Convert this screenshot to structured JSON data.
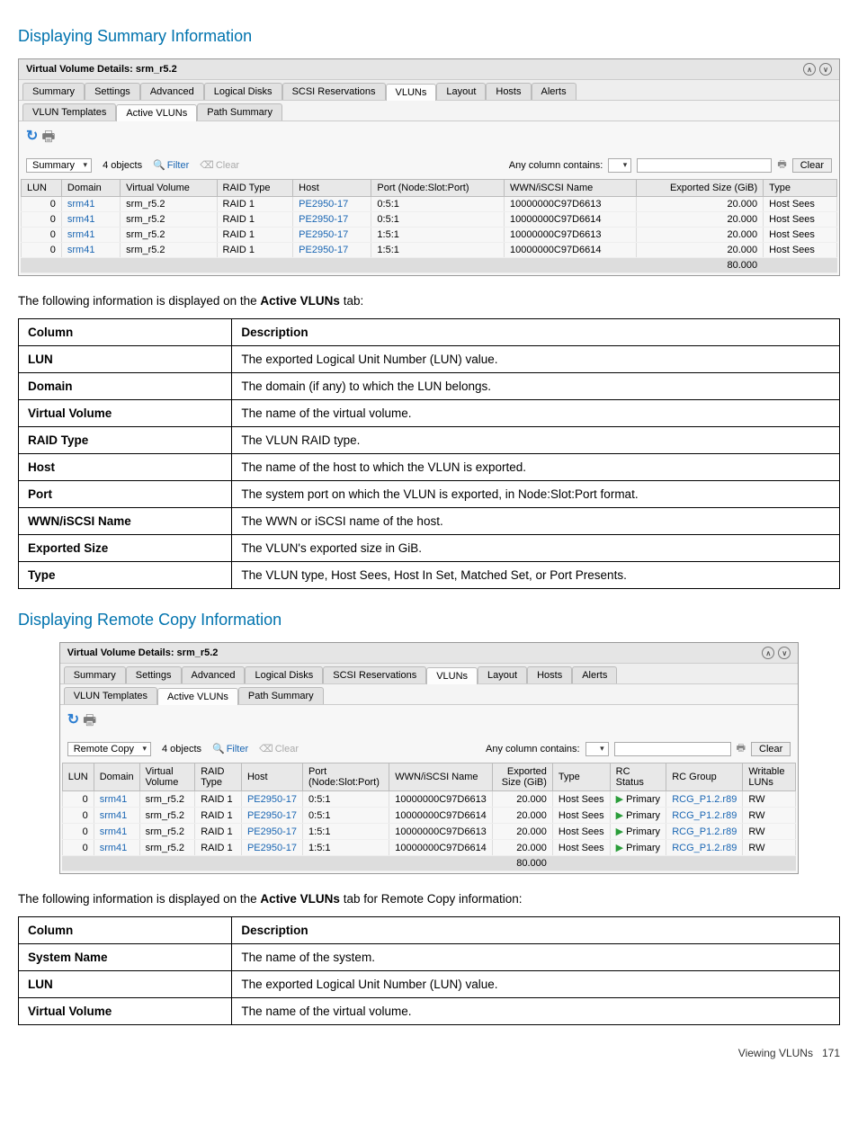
{
  "section1_title": "Displaying Summary Information",
  "section2_title": "Displaying Remote Copy Information",
  "ss1": {
    "title": "Virtual Volume Details: srm_r5.2",
    "tabs": [
      "Summary",
      "Settings",
      "Advanced",
      "Logical Disks",
      "SCSI Reservations",
      "VLUNs",
      "Layout",
      "Hosts",
      "Alerts"
    ],
    "active_tab": "VLUNs",
    "subtabs": [
      "VLUN Templates",
      "Active VLUNs",
      "Path Summary"
    ],
    "active_subtab": "Active VLUNs",
    "view_dd": "Summary",
    "objects": "4 objects",
    "filter": "Filter",
    "clear": "Clear",
    "anycol": "Any column contains:",
    "clear_btn": "Clear",
    "headers": [
      "LUN",
      "Domain",
      "Virtual Volume",
      "RAID Type",
      "Host",
      "Port (Node:Slot:Port)",
      "WWN/iSCSI Name",
      "Exported Size (GiB)",
      "Type"
    ],
    "rows": [
      {
        "lun": "0",
        "domain": "srm41",
        "vv": "srm_r5.2",
        "raid": "RAID 1",
        "host": "PE2950-17",
        "port": "0:5:1",
        "wwn": "10000000C97D6613",
        "size": "20.000",
        "type": "Host Sees"
      },
      {
        "lun": "0",
        "domain": "srm41",
        "vv": "srm_r5.2",
        "raid": "RAID 1",
        "host": "PE2950-17",
        "port": "0:5:1",
        "wwn": "10000000C97D6614",
        "size": "20.000",
        "type": "Host Sees"
      },
      {
        "lun": "0",
        "domain": "srm41",
        "vv": "srm_r5.2",
        "raid": "RAID 1",
        "host": "PE2950-17",
        "port": "1:5:1",
        "wwn": "10000000C97D6613",
        "size": "20.000",
        "type": "Host Sees"
      },
      {
        "lun": "0",
        "domain": "srm41",
        "vv": "srm_r5.2",
        "raid": "RAID 1",
        "host": "PE2950-17",
        "port": "1:5:1",
        "wwn": "10000000C97D6614",
        "size": "20.000",
        "type": "Host Sees"
      }
    ],
    "total": "80.000"
  },
  "text1": "The following information is displayed on the ",
  "text1_bold": "Active VLUNs",
  "text1_rest": " tab:",
  "doc1": {
    "h0": "Column",
    "h1": "Description",
    "rows": [
      {
        "c": "LUN",
        "d": "The exported Logical Unit Number (LUN) value."
      },
      {
        "c": "Domain",
        "d": "The domain (if any) to which the LUN belongs."
      },
      {
        "c": "Virtual Volume",
        "d": "The name of the virtual volume."
      },
      {
        "c": "RAID Type",
        "d": "The VLUN RAID type."
      },
      {
        "c": "Host",
        "d": "The name of the host to which the VLUN is exported."
      },
      {
        "c": "Port",
        "d": "The system port on which the VLUN is exported, in Node:Slot:Port format."
      },
      {
        "c": "WWN/iSCSI Name",
        "d": "The WWN or iSCSI name of the host."
      },
      {
        "c": "Exported Size",
        "d": "The VLUN's exported size in GiB."
      },
      {
        "c": "Type",
        "d": "The VLUN type, Host Sees, Host In Set, Matched Set, or Port Presents."
      }
    ]
  },
  "ss2": {
    "title": "Virtual Volume Details: srm_r5.2",
    "tabs": [
      "Summary",
      "Settings",
      "Advanced",
      "Logical Disks",
      "SCSI Reservations",
      "VLUNs",
      "Layout",
      "Hosts",
      "Alerts"
    ],
    "active_tab": "VLUNs",
    "subtabs": [
      "VLUN Templates",
      "Active VLUNs",
      "Path Summary"
    ],
    "active_subtab": "Active VLUNs",
    "view_dd": "Remote Copy",
    "objects": "4 objects",
    "filter": "Filter",
    "clear": "Clear",
    "anycol": "Any column contains:",
    "clear_btn": "Clear",
    "headers": [
      "LUN",
      "Domain",
      "Virtual Volume",
      "RAID Type",
      "Host",
      "Port (Node:Slot:Port)",
      "WWN/iSCSI Name",
      "Exported Size (GiB)",
      "Type",
      "RC Status",
      "RC Group",
      "Writable LUNs"
    ],
    "rows": [
      {
        "lun": "0",
        "domain": "srm41",
        "vv": "srm_r5.2",
        "raid": "RAID 1",
        "host": "PE2950-17",
        "port": "0:5:1",
        "wwn": "10000000C97D6613",
        "size": "20.000",
        "type": "Host Sees",
        "rcs": "Primary",
        "rcg": "RCG_P1.2.r89",
        "wl": "RW"
      },
      {
        "lun": "0",
        "domain": "srm41",
        "vv": "srm_r5.2",
        "raid": "RAID 1",
        "host": "PE2950-17",
        "port": "0:5:1",
        "wwn": "10000000C97D6614",
        "size": "20.000",
        "type": "Host Sees",
        "rcs": "Primary",
        "rcg": "RCG_P1.2.r89",
        "wl": "RW"
      },
      {
        "lun": "0",
        "domain": "srm41",
        "vv": "srm_r5.2",
        "raid": "RAID 1",
        "host": "PE2950-17",
        "port": "1:5:1",
        "wwn": "10000000C97D6613",
        "size": "20.000",
        "type": "Host Sees",
        "rcs": "Primary",
        "rcg": "RCG_P1.2.r89",
        "wl": "RW"
      },
      {
        "lun": "0",
        "domain": "srm41",
        "vv": "srm_r5.2",
        "raid": "RAID 1",
        "host": "PE2950-17",
        "port": "1:5:1",
        "wwn": "10000000C97D6614",
        "size": "20.000",
        "type": "Host Sees",
        "rcs": "Primary",
        "rcg": "RCG_P1.2.r89",
        "wl": "RW"
      }
    ],
    "total": "80.000"
  },
  "text2": "The following information is displayed on the ",
  "text2_bold": "Active VLUNs",
  "text2_rest": " tab for Remote Copy information:",
  "doc2": {
    "h0": "Column",
    "h1": "Description",
    "rows": [
      {
        "c": "System Name",
        "d": "The name of the system."
      },
      {
        "c": "LUN",
        "d": "The exported Logical Unit Number (LUN) value."
      },
      {
        "c": "Virtual Volume",
        "d": "The name of the virtual volume."
      }
    ]
  },
  "footer": {
    "label": "Viewing VLUNs",
    "page": "171"
  }
}
